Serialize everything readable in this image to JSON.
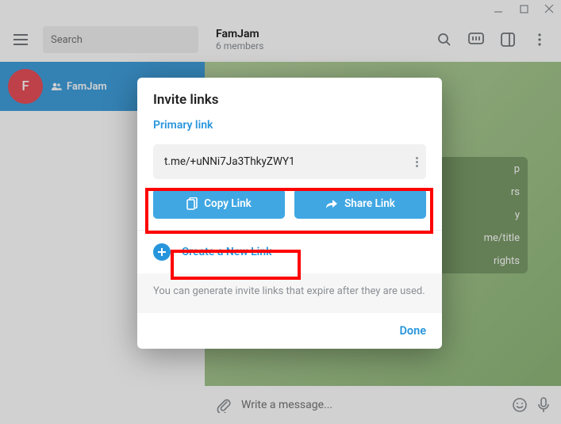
{
  "titlebar": {},
  "search": {
    "placeholder": "Search"
  },
  "chat_list": {
    "item0": {
      "avatar_letter": "F",
      "name": "FamJam"
    }
  },
  "header": {
    "title": "FamJam",
    "subtitle": "6 members"
  },
  "panel_frag": {
    "r0": "p",
    "r1": "rs",
    "r2": "y",
    "r3": "me/title",
    "r4": "rights"
  },
  "composer": {
    "placeholder": "Write a message..."
  },
  "modal": {
    "title": "Invite links",
    "primary_label": "Primary link",
    "link_value": "t.me/+uNNi7Ja3ThkyZWY1",
    "copy_label": "Copy Link",
    "share_label": "Share Link",
    "create_label": "Create a New Link",
    "hint": "You can generate invite links that expire after they are used.",
    "done_label": "Done"
  }
}
